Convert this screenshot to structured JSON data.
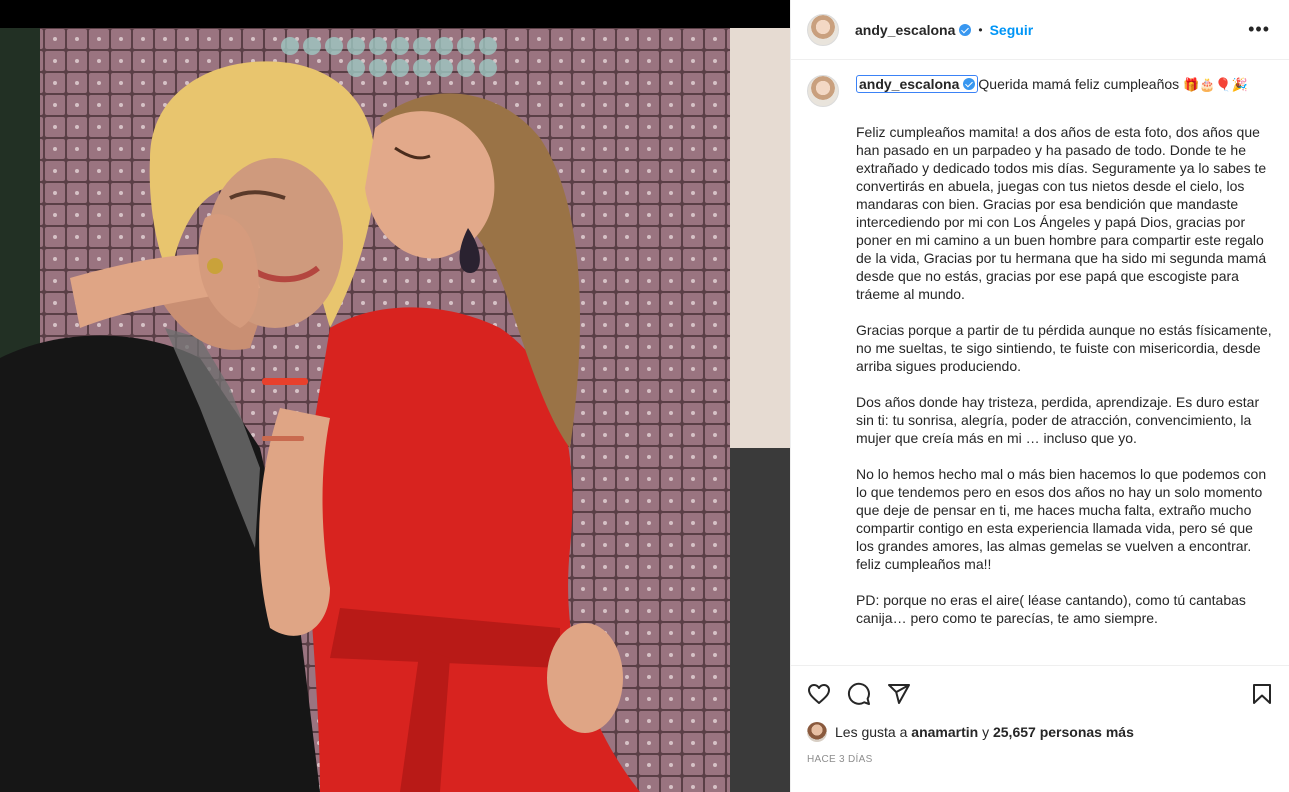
{
  "post": {
    "username": "andy_escalona",
    "dot": "•",
    "follow_label": "Seguir",
    "more_label": "•••",
    "caption_title": "Querida mamá feliz cumpleaños",
    "caption_title_emojis": "🎁🎂🎈🎉",
    "paragraphs": [
      "Feliz cumpleaños mamita! a dos años de esta foto, dos años que han pasado en un parpadeo y ha pasado de todo. Donde te he extrañado y dedicado todos mis días. Seguramente ya lo sabes te convertirás en abuela, juegas con tus nietos desde el cielo, los mandaras con bien. Gracias por esa bendición que mandaste intercediendo por mi con Los Ángeles y papá Dios, gracias por poner en mi camino a un buen hombre para compartir este regalo de la vida, Gracias por tu hermana que ha sido mi segunda mamá desde que no estás, gracias por ese papá que escogiste para tráeme al mundo.",
      "Gracias porque a partir de tu pérdida aunque no estás físicamente, no me sueltas, te sigo sintiendo, te fuiste con misericordia, desde arriba sigues produciendo.",
      "Dos años donde hay tristeza, perdida, aprendizaje. Es duro estar sin ti: tu sonrisa, alegría, poder de atracción, convencimiento, la mujer que creía más en mi … incluso que yo.",
      "No lo hemos hecho mal o más bien hacemos lo que podemos con lo que tendemos pero en esos dos años no hay un solo momento que deje de pensar en ti, me haces mucha falta, extraño mucho compartir contigo en esta experiencia llamada vida, pero sé que los grandes amores, las almas gemelas se vuelven a encontrar. feliz cumpleaños ma!!",
      "PD: porque no eras el aire( léase cantando), como tú cantabas canija… pero como te parecías, te amo siempre."
    ],
    "likes_prefix": "Les gusta a",
    "likes_user": "anamartin",
    "likes_join": "y",
    "likes_count": "25,657 personas más",
    "timestamp": "Hace 3 días"
  },
  "icons": {
    "like": "heart-icon",
    "comment": "comment-icon",
    "share": "share-icon",
    "save": "bookmark-icon",
    "verified": "verified-badge-icon"
  },
  "colors": {
    "link": "#0095f6",
    "verified": "#3897f0",
    "text": "#262626",
    "muted": "#8e8e8e"
  }
}
